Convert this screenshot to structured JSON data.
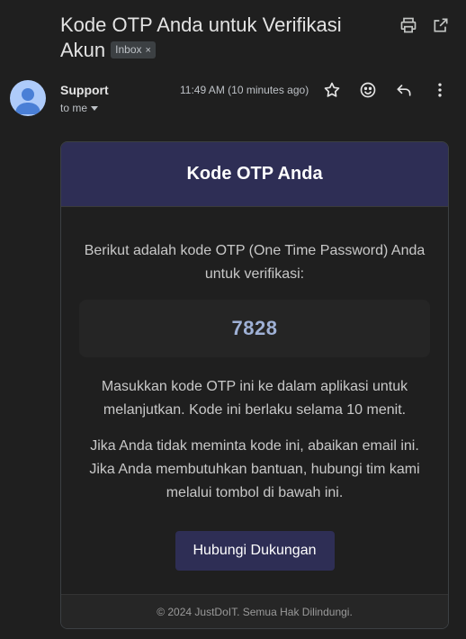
{
  "email": {
    "subject": "Kode OTP Anda untuk Verifikasi Akun",
    "label": "Inbox",
    "label_close": "×",
    "sender": "Support",
    "recipient": "to me",
    "timestamp": "11:49 AM (10 minutes ago)"
  },
  "toolbar_icons": [
    "print-icon",
    "open-in-new-window-icon"
  ],
  "action_icons": [
    "star-icon",
    "emoji-react-icon",
    "reply-icon",
    "more-vertical-icon"
  ],
  "body": {
    "header_title": "Kode OTP Anda",
    "intro": "Berikut adalah kode OTP (One Time Password) Anda untuk verifikasi:",
    "otp_code": "7828",
    "instruction": "Masukkan kode OTP ini ke dalam aplikasi untuk melanjutkan. Kode ini berlaku selama 10 menit.",
    "help": "Jika Anda tidak meminta kode ini, abaikan email ini. Jika Anda membutuhkan bantuan, hubungi tim kami melalui tombol di bawah ini.",
    "button_label": "Hubungi Dukungan",
    "footer": "© 2024 JustDoIT. Semua Hak Dilindungi."
  },
  "colors": {
    "background": "#1f1f1f",
    "header_accent": "#2e2e55",
    "otp_text": "#9fb1d6",
    "avatar": "#aecbfa"
  }
}
